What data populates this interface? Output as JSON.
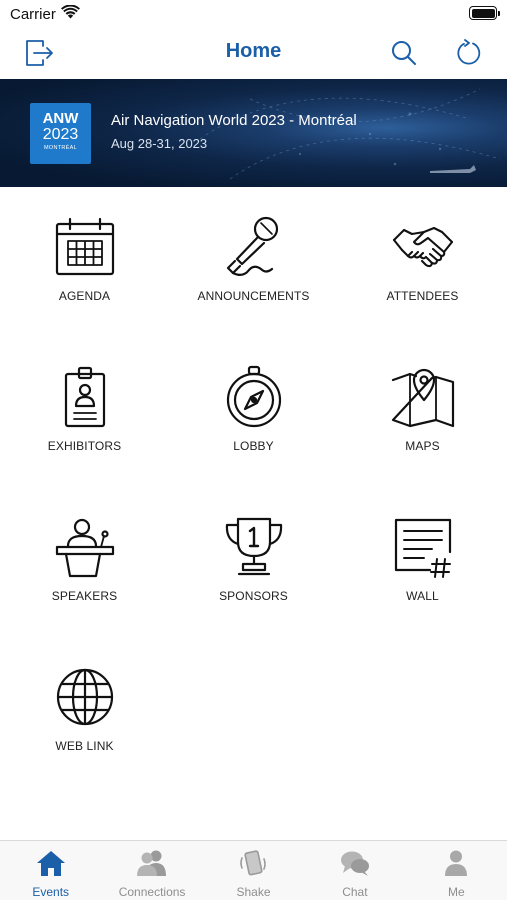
{
  "status": {
    "carrier": "Carrier"
  },
  "nav": {
    "title": "Home",
    "icons": [
      "logout-icon",
      "search-icon",
      "refresh-icon"
    ]
  },
  "event": {
    "logo": {
      "line1": "ANW",
      "line2": "2023",
      "line3": "MONTRÉAL"
    },
    "title": "Air Navigation World 2023 - Montréal",
    "dates": "Aug 28-31, 2023"
  },
  "menu": [
    {
      "label": "AGENDA",
      "icon": "calendar-icon"
    },
    {
      "label": "ANNOUNCEMENTS",
      "icon": "microphone-icon"
    },
    {
      "label": "ATTENDEES",
      "icon": "handshake-icon"
    },
    {
      "label": "EXHIBITORS",
      "icon": "id-badge-icon"
    },
    {
      "label": "LOBBY",
      "icon": "compass-icon"
    },
    {
      "label": "MAPS",
      "icon": "map-icon"
    },
    {
      "label": "SPEAKERS",
      "icon": "speaker-podium-icon"
    },
    {
      "label": "SPONSORS",
      "icon": "trophy-icon"
    },
    {
      "label": "WALL",
      "icon": "wall-icon"
    },
    {
      "label": "WEB LINK",
      "icon": "globe-icon"
    }
  ],
  "tabs": [
    {
      "label": "Events",
      "icon": "home-icon",
      "active": true
    },
    {
      "label": "Connections",
      "icon": "connections-icon",
      "active": false
    },
    {
      "label": "Shake",
      "icon": "shake-phone-icon",
      "active": false
    },
    {
      "label": "Chat",
      "icon": "chat-icon",
      "active": false
    },
    {
      "label": "Me",
      "icon": "person-icon",
      "active": false
    }
  ],
  "colors": {
    "accent": "#1b5fa8",
    "logo_bg": "#1f7acb",
    "tab_inactive": "#8e8e8e",
    "banner_dark": "#0e2648"
  }
}
